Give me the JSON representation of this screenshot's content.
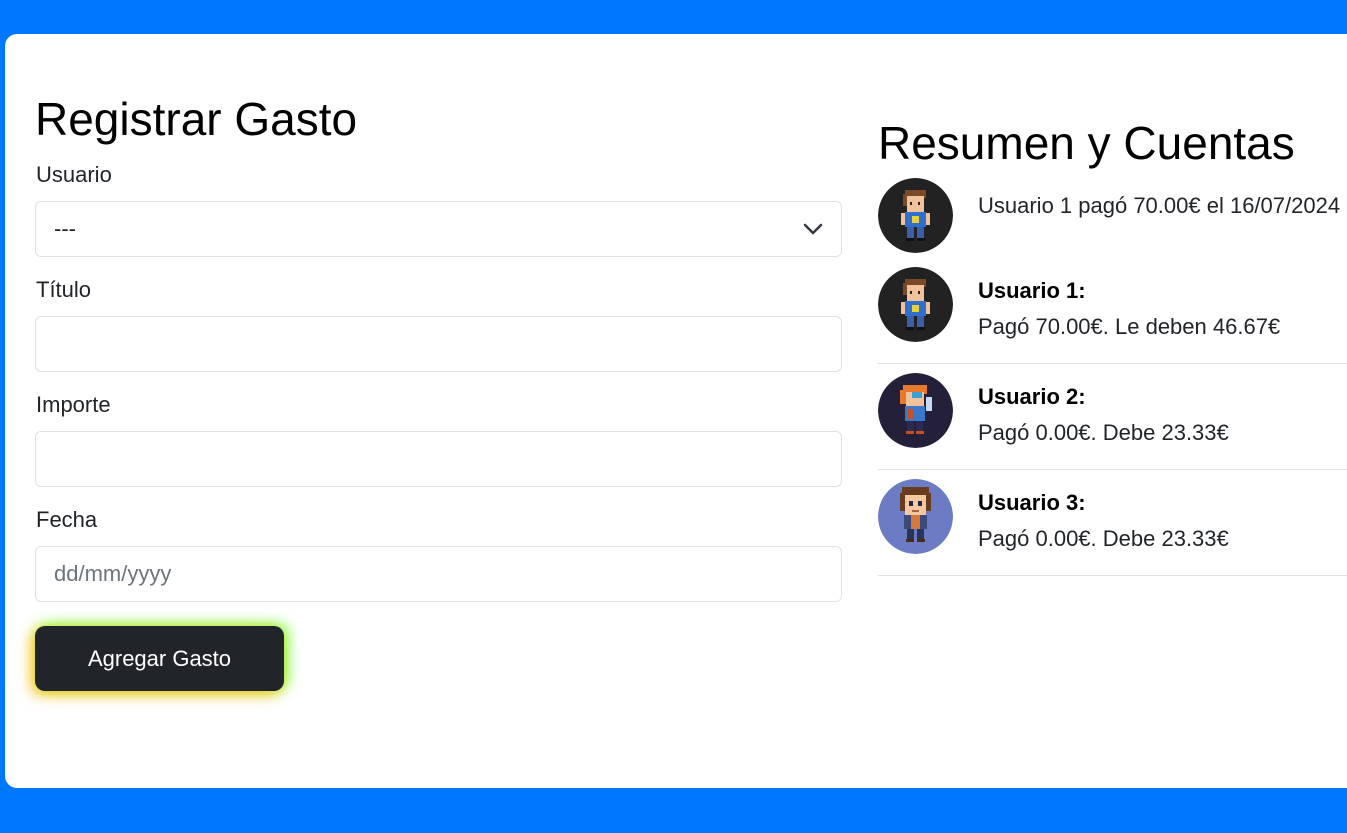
{
  "form": {
    "title": "Registrar Gasto",
    "user_label": "Usuario",
    "user_selected": "---",
    "title_label": "Título",
    "title_value": "",
    "amount_label": "Importe",
    "amount_value": "",
    "date_label": "Fecha",
    "date_placeholder": "dd/mm/yyyy",
    "submit_label": "Agregar Gasto"
  },
  "summary": {
    "title": "Resumen y Cuentas",
    "payments": [
      {
        "text": "Usuario 1 pagó 70.00€ el 16/07/2024",
        "avatar": "avatar-1"
      }
    ],
    "users": [
      {
        "name": "Usuario 1:",
        "detail": "Pagó 70.00€. Le deben 46.67€",
        "avatar": "avatar-1",
        "avatar_bg": "#222222"
      },
      {
        "name": "Usuario 2:",
        "detail": "Pagó 0.00€. Debe 23.33€",
        "avatar": "avatar-2",
        "avatar_bg": "#24203a"
      },
      {
        "name": "Usuario 3:",
        "detail": "Pagó 0.00€. Debe 23.33€",
        "avatar": "avatar-3",
        "avatar_bg": "#6b7bc4"
      }
    ]
  },
  "colors": {
    "background": "#0077ff",
    "card": "#ffffff",
    "button": "#212529"
  }
}
